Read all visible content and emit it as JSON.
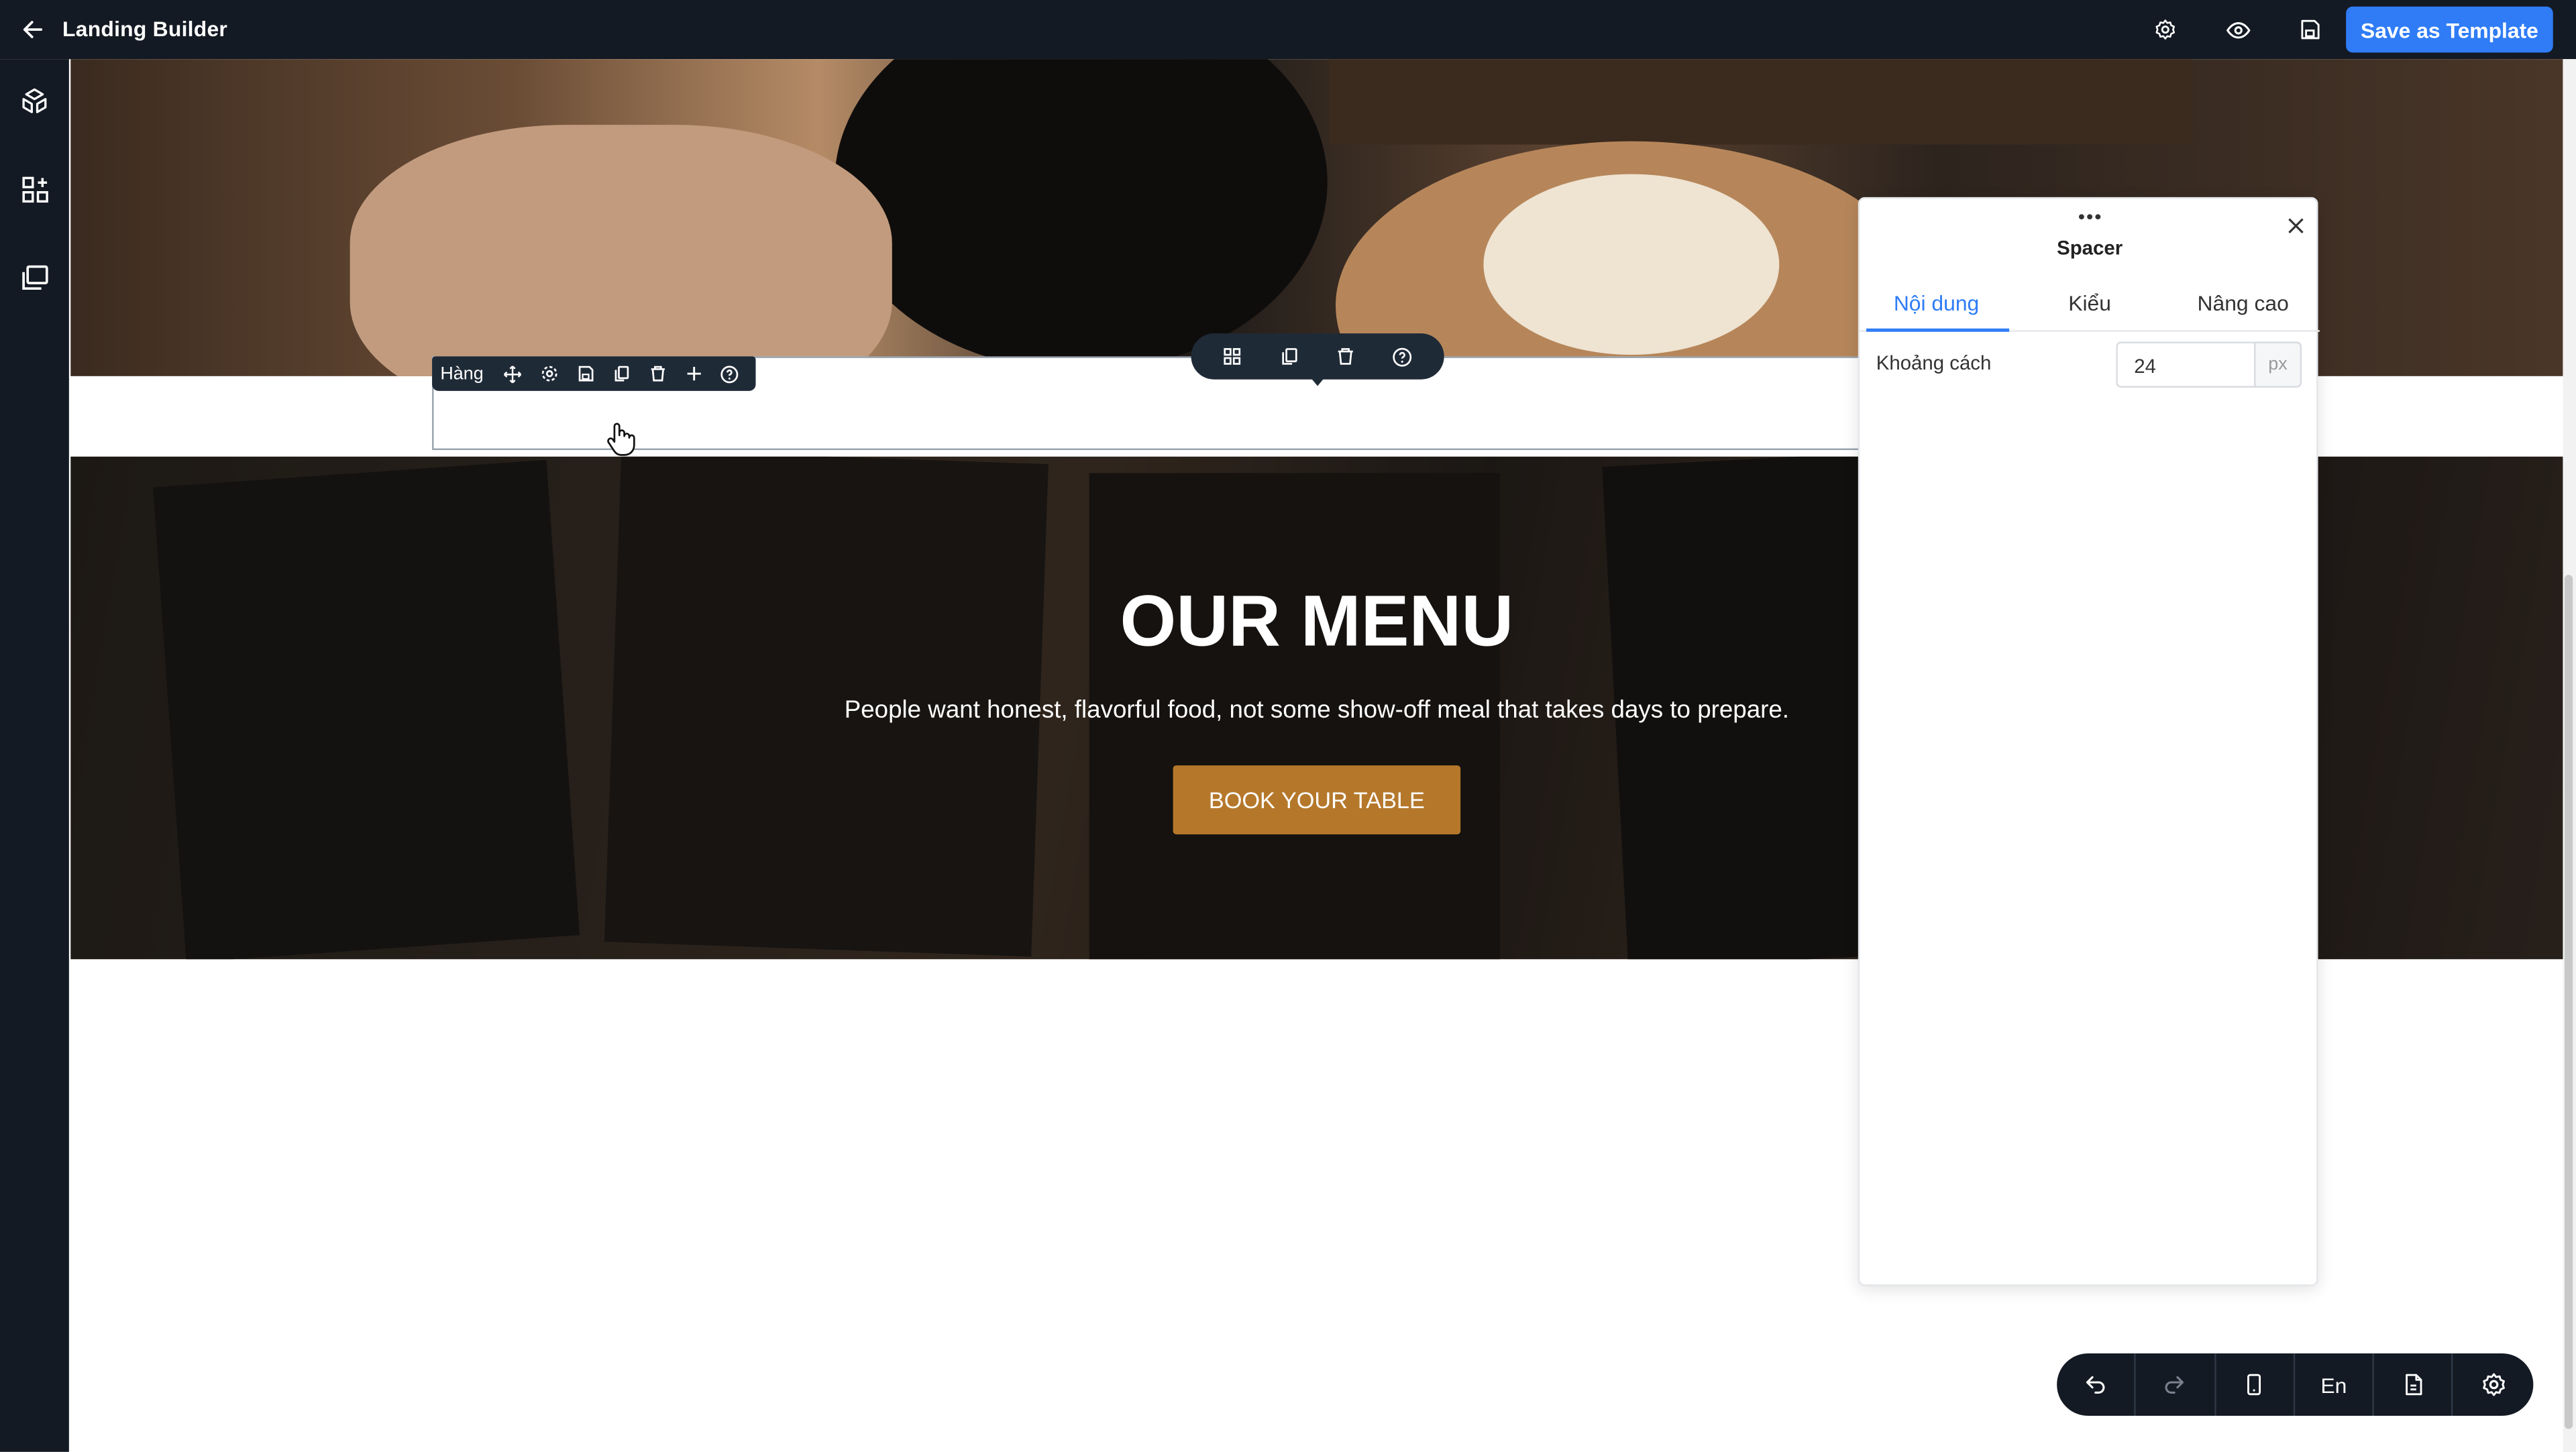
{
  "app": {
    "title": "Landing Builder",
    "save_label": "Save as Template"
  },
  "topbar_icons": [
    "back-arrow-icon",
    "settings-gear-icon",
    "preview-eye-icon",
    "save-disk-icon"
  ],
  "sidebar": {
    "items": [
      "layers-icon",
      "add-widgets-icon",
      "pages-icon"
    ]
  },
  "canvas": {
    "menu_section": {
      "heading": "OUR MENU",
      "subtext": "People want honest, flavorful food, not some show-off meal that takes days to prepare.",
      "button_label": "BOOK YOUR TABLE",
      "button_color": "#b5782b"
    }
  },
  "row_toolbar": {
    "label": "Hàng",
    "icons": [
      "move-icon",
      "settings-icon",
      "save-icon",
      "duplicate-icon",
      "delete-icon",
      "add-icon",
      "help-icon"
    ]
  },
  "element_toolbar": {
    "icons": [
      "grid-icon",
      "duplicate-icon",
      "delete-icon",
      "help-icon"
    ]
  },
  "panel": {
    "title": "Spacer",
    "tabs": [
      {
        "label": "Nội dung",
        "active": true
      },
      {
        "label": "Kiểu",
        "active": false
      },
      {
        "label": "Nâng cao",
        "active": false
      }
    ],
    "field": {
      "label": "Khoảng cách",
      "value": "24",
      "unit": "px"
    }
  },
  "bottom_toolbar": {
    "language": "En",
    "icons": [
      "undo-icon",
      "redo-icon",
      "mobile-view-icon",
      "language",
      "page-icon",
      "settings-icon"
    ]
  },
  "colors": {
    "accent": "#2f7cf6",
    "dark": "#141a23"
  }
}
